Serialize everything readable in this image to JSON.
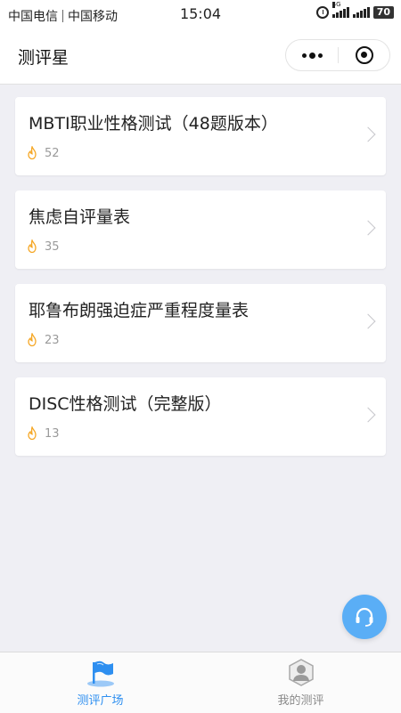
{
  "status_bar": {
    "carrier_1": "中国电信",
    "carrier_2": "中国移动",
    "time": "15:04",
    "network_type": "4G",
    "battery": "70"
  },
  "nav": {
    "title": "测评星"
  },
  "cards": [
    {
      "title": "MBTI职业性格测试（48题版本）",
      "count": "52"
    },
    {
      "title": "焦虑自评量表",
      "count": "35"
    },
    {
      "title": "耶鲁布朗强迫症严重程度量表",
      "count": "23"
    },
    {
      "title": "DISC性格测试（完整版）",
      "count": "13"
    }
  ],
  "tabs": [
    {
      "label": "测评广场",
      "icon": "flag-icon",
      "active": true
    },
    {
      "label": "我的测评",
      "icon": "user-icon",
      "active": false
    }
  ],
  "colors": {
    "accent": "#2e8ff0",
    "fab": "#5aaef6",
    "flame": "#f5a623",
    "background": "#efeff4"
  }
}
